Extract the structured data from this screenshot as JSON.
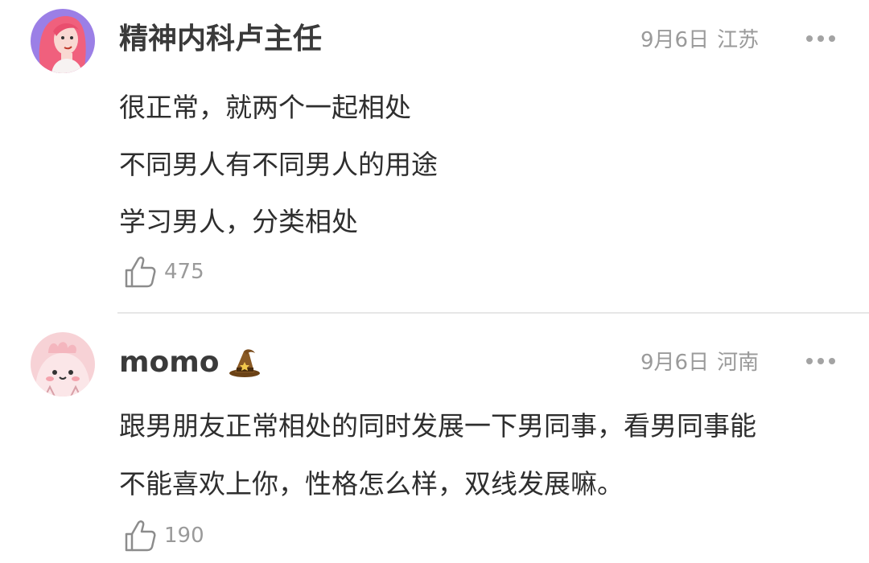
{
  "comments": [
    {
      "username": "精神内科卢主任",
      "date": "9月6日",
      "region": "江苏",
      "lines": [
        "很正常，就两个一起相处",
        "不同男人有不同男人的用途",
        "学习男人，分类相处"
      ],
      "likes": "475",
      "avatar_icon": "pink-haired-girl-avatar",
      "badge_icon": null
    },
    {
      "username": "momo",
      "date": "9月6日",
      "region": "河南",
      "lines": [
        "跟男朋友正常相处的同时发展一下男同事，看男同事能",
        "不能喜欢上你，性格怎么样，双线发展嘛。"
      ],
      "likes": "190",
      "avatar_icon": "pink-blob-avatar",
      "badge_icon": "wizard-hat-icon"
    }
  ],
  "colors": {
    "meta_text": "#9a9a9a",
    "body_text": "#2e2e2e",
    "avatar1_bg": "#9b7fe6",
    "avatar2_bg": "#f7d2d6",
    "divider": "#e6e6e6"
  },
  "icons": {
    "like": "thumbs-up-icon",
    "more": "more-dots-icon"
  }
}
